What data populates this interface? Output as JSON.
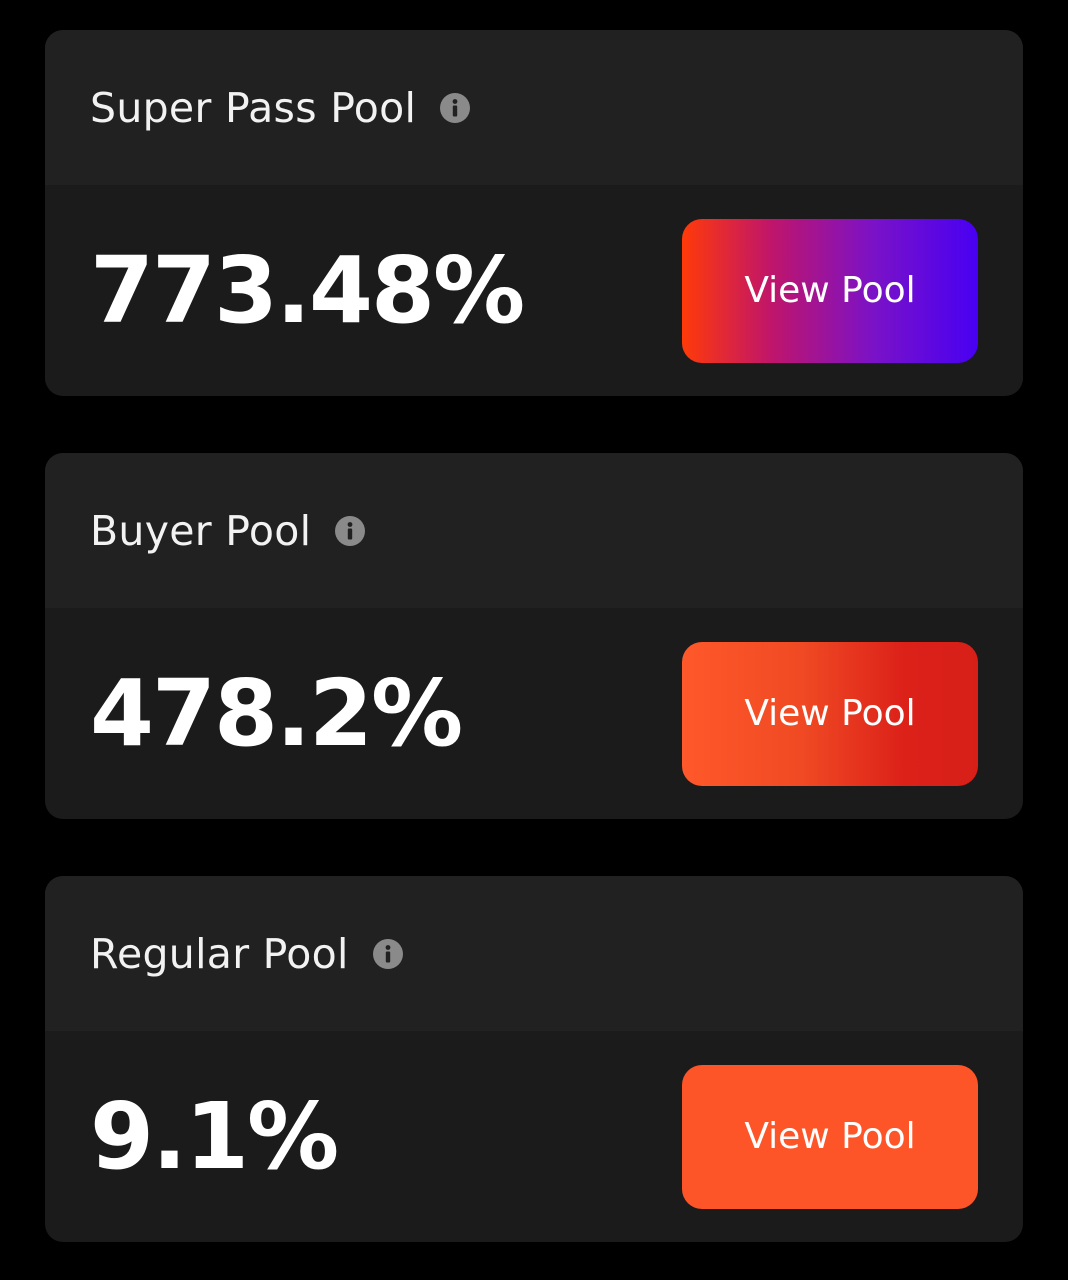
{
  "pools": [
    {
      "title": "Super Pass Pool",
      "info_icon": "info-icon",
      "value": "773.48%",
      "button_label": "View Pool",
      "button_gradient": [
        "#ff3a08",
        "#c0156a",
        "#7a12c8",
        "#4800f2"
      ]
    },
    {
      "title": "Buyer Pool",
      "info_icon": "info-icon",
      "value": "478.2%",
      "button_label": "View Pool",
      "button_gradient": [
        "#ff582a",
        "#dc2119"
      ]
    },
    {
      "title": "Regular Pool",
      "info_icon": "info-icon",
      "value": "9.1%",
      "button_label": "View Pool",
      "button_color": "#fe5528"
    }
  ],
  "colors": {
    "background": "#000000",
    "card_header": "#212121",
    "card_body": "#1b1b1b",
    "text": "#ffffff",
    "icon": "#8a8a8a"
  }
}
